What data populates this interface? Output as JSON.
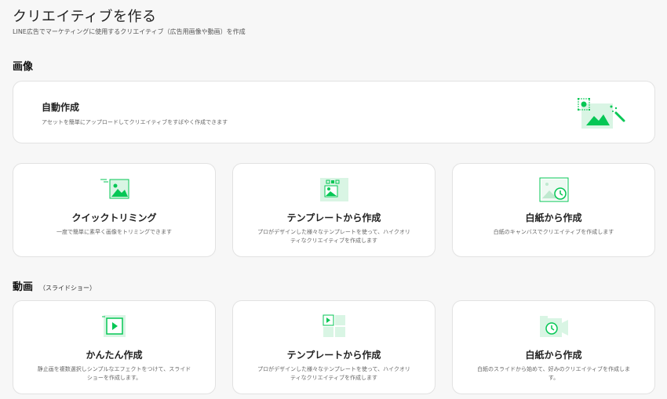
{
  "header": {
    "title": "クリエイティブを作る",
    "subtitle": "LINE広告でマーケティングに使用するクリエイティブ（広告用画像や動画）を作成"
  },
  "image_section": {
    "title": "画像",
    "auto_card": {
      "title": "自動作成",
      "desc": "アセットを簡単にアップロードしてクリエイティブをすばやく作成できます"
    },
    "cards": [
      {
        "title": "クイックトリミング",
        "desc": "一度で簡単に素早く画像をトリミングできます"
      },
      {
        "title": "テンプレートから作成",
        "desc": "プロがデザインした様々なテンプレートを使って、ハイクオリティなクリエイティブを作成します"
      },
      {
        "title": "白紙から作成",
        "desc": "白紙のキャンバスでクリエイティブを作成します"
      }
    ]
  },
  "video_section": {
    "title": "動画",
    "subtitle": "（スライドショー）",
    "cards": [
      {
        "title": "かんたん作成",
        "desc": "静止画を複数選択しシンプルなエフェクトをつけて、スライドショーを作成します。"
      },
      {
        "title": "テンプレートから作成",
        "desc": "プロがデザインした様々なテンプレートを使って、ハイクオリティなクリエイティブを作成します"
      },
      {
        "title": "白紙から作成",
        "desc": "白紙のスライドから始めて、好みのクリエイティブを作成します。"
      }
    ]
  },
  "colors": {
    "accent": "#06c755",
    "accent_light": "#d9f5e4",
    "card_bg": "#ffffff",
    "page_bg": "#f7f7f7"
  }
}
